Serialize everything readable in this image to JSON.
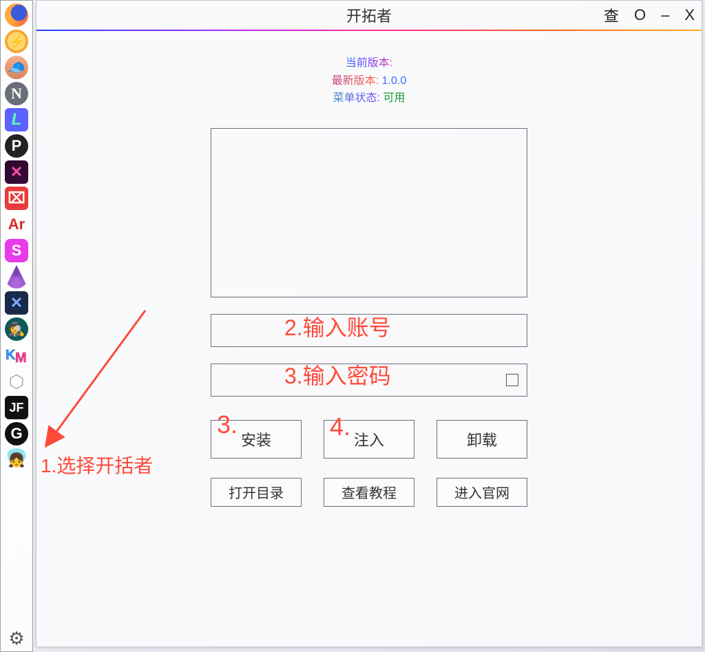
{
  "sidebar": {
    "items": [
      {
        "name": "firefox-icon"
      },
      {
        "name": "flash-icon"
      },
      {
        "name": "face-icon"
      },
      {
        "name": "n-icon",
        "glyph": "N"
      },
      {
        "name": "l-icon",
        "glyph": "L"
      },
      {
        "name": "p-icon",
        "glyph": "P"
      },
      {
        "name": "x-icon",
        "glyph": "✕"
      },
      {
        "name": "box-icon",
        "glyph": "⌧"
      },
      {
        "name": "ar-icon",
        "glyph": "Ar"
      },
      {
        "name": "s-icon",
        "glyph": "S"
      },
      {
        "name": "triangle-icon"
      },
      {
        "name": "xx-icon",
        "glyph": "✕"
      },
      {
        "name": "hood-icon",
        "glyph": "🕵"
      },
      {
        "name": "km-icon"
      },
      {
        "name": "cube-icon",
        "glyph": "⬡"
      },
      {
        "name": "jf-icon",
        "glyph": "JF"
      },
      {
        "name": "g-icon",
        "glyph": "G"
      },
      {
        "name": "girl-icon"
      }
    ],
    "settings_name": "settings-gear-icon"
  },
  "window": {
    "title": "开拓者",
    "controls": {
      "cha": "查",
      "min": "O",
      "dash": "–",
      "close": "X"
    }
  },
  "version": {
    "current_label": "当前版本:",
    "current_value": "",
    "latest_label": "最新版本:",
    "latest_value": "1.0.0",
    "menu_label": "菜单状态:",
    "menu_value": "可用"
  },
  "fields": {
    "account_placeholder": "",
    "password_placeholder": ""
  },
  "buttons": {
    "install": "安装",
    "inject": "注入",
    "uninstall": "卸载",
    "open_dir": "打开目录",
    "view_tutorial": "查看教程",
    "official_site": "进入官网"
  },
  "annotations": {
    "step1": "1.选择开括者",
    "step2": "2.输入账号",
    "step3": "3.输入密码",
    "badge3": "3.",
    "badge4": "4."
  }
}
